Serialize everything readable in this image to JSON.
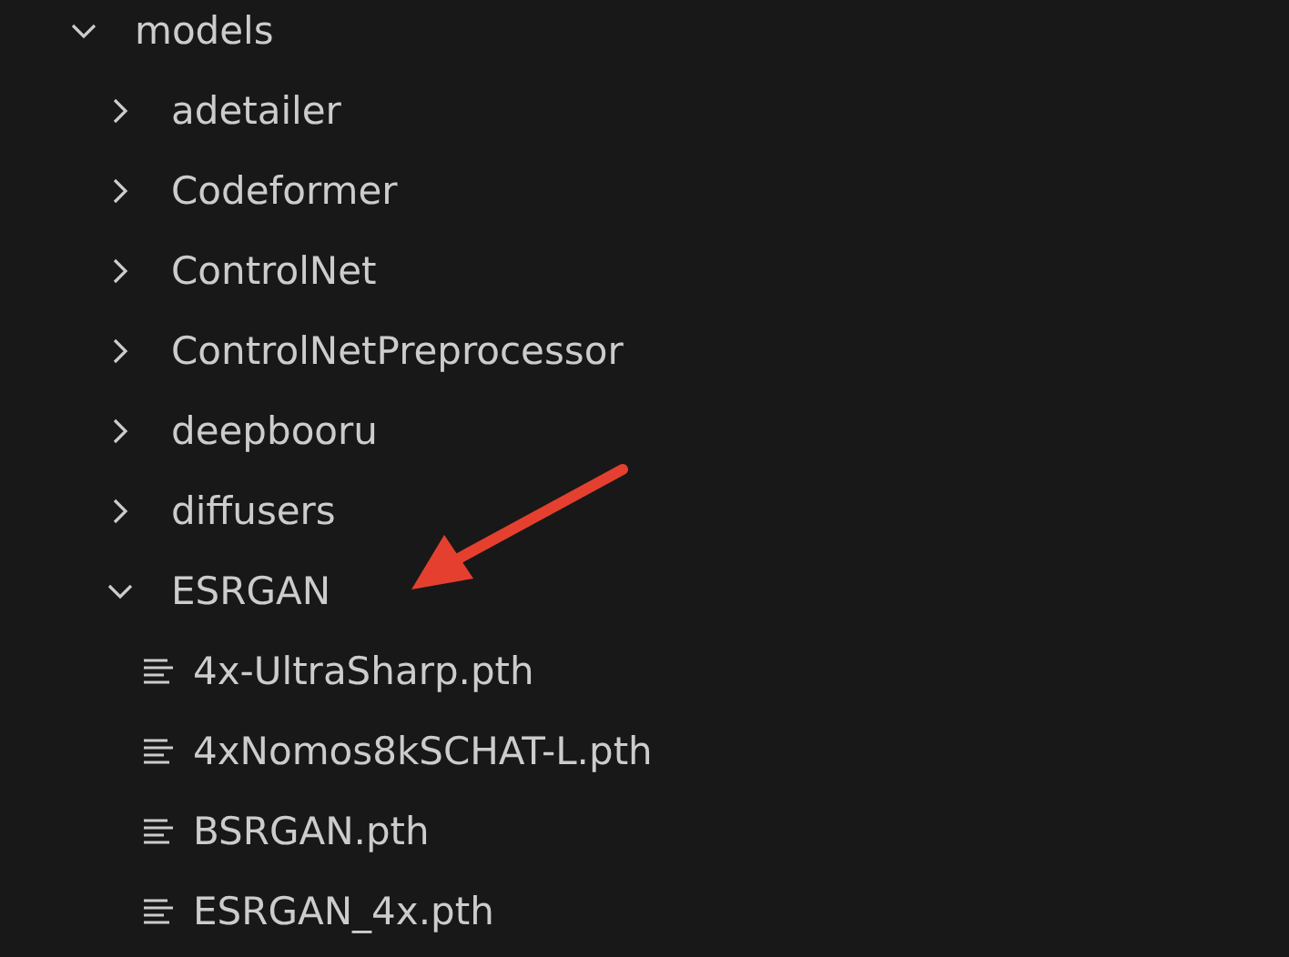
{
  "tree": [
    {
      "kind": "folder",
      "label": "models",
      "expanded": true,
      "children": [
        {
          "kind": "folder",
          "label": "adetailer",
          "expanded": false
        },
        {
          "kind": "folder",
          "label": "Codeformer",
          "expanded": false
        },
        {
          "kind": "folder",
          "label": "ControlNet",
          "expanded": false
        },
        {
          "kind": "folder",
          "label": "ControlNetPreprocessor",
          "expanded": false
        },
        {
          "kind": "folder",
          "label": "deepbooru",
          "expanded": false
        },
        {
          "kind": "folder",
          "label": "diffusers",
          "expanded": false
        },
        {
          "kind": "folder",
          "label": "ESRGAN",
          "expanded": true,
          "children": [
            {
              "kind": "file",
              "label": "4x-UltraSharp.pth"
            },
            {
              "kind": "file",
              "label": "4xNomos8kSCHAT-L.pth"
            },
            {
              "kind": "file",
              "label": "BSRGAN.pth"
            },
            {
              "kind": "file",
              "label": "ESRGAN_4x.pth"
            }
          ]
        }
      ]
    }
  ]
}
